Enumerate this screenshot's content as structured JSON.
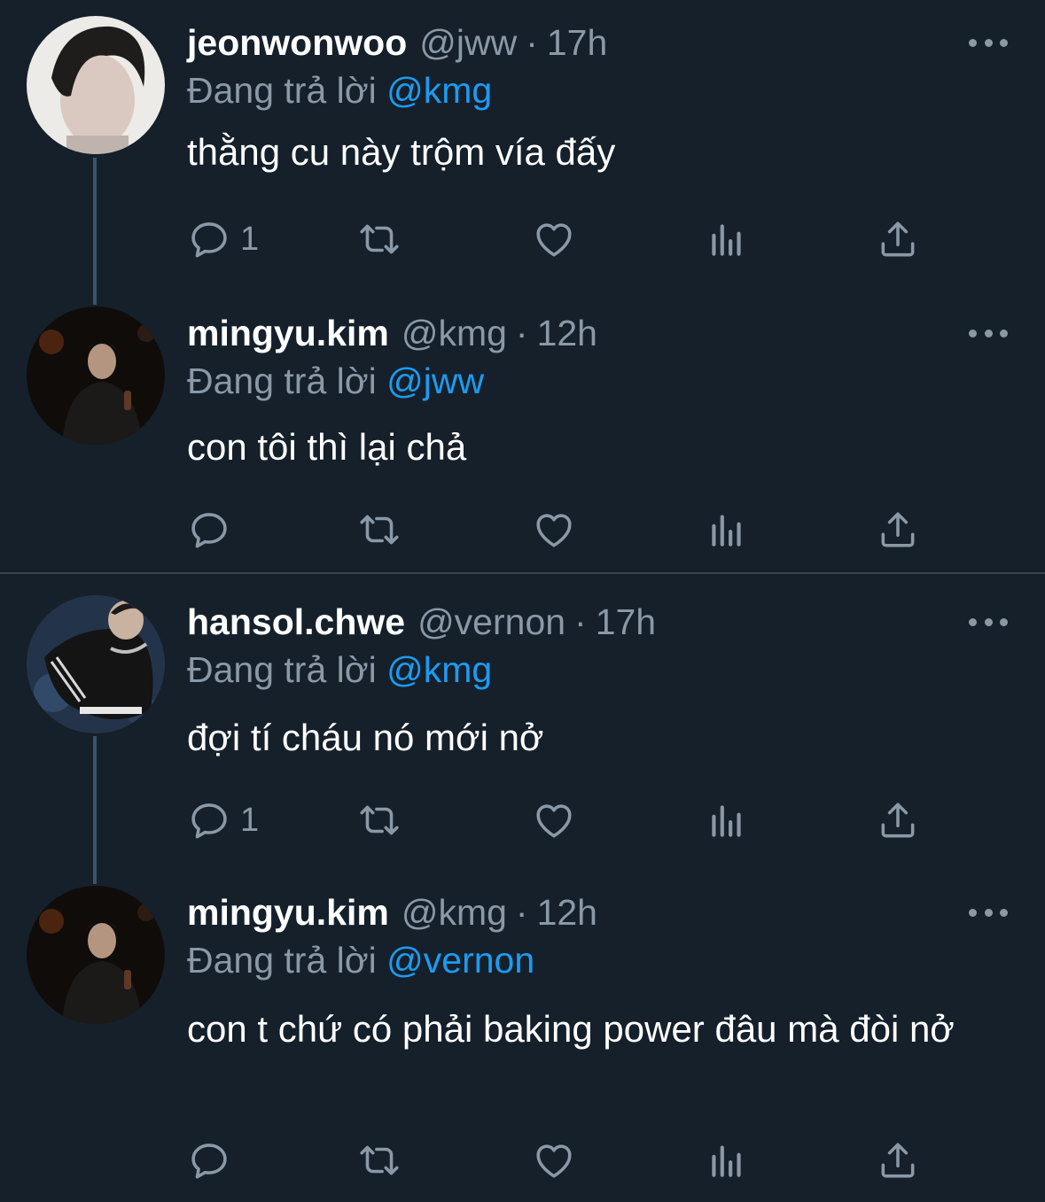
{
  "reply_prefix": "Đang trả lời",
  "tweets": [
    {
      "name": "jeonwonwoo",
      "handle": "@jww",
      "separator": "·",
      "time": "17h",
      "reply_to": "@kmg",
      "text": "thằng cu này trộm vía đấy",
      "reply_count": "1"
    },
    {
      "name": "mingyu.kim",
      "handle": "@kmg",
      "separator": "·",
      "time": "12h",
      "reply_to": "@jww",
      "text": "con tôi thì lại chả",
      "reply_count": ""
    },
    {
      "name": "hansol.chwe",
      "handle": "@vernon",
      "separator": "·",
      "time": "17h",
      "reply_to": "@kmg",
      "text": "đợi tí cháu nó mới nở",
      "reply_count": "1"
    },
    {
      "name": "mingyu.kim",
      "handle": "@kmg",
      "separator": "·",
      "time": "12h",
      "reply_to": "@vernon",
      "text": "con t chứ có phải baking power đâu mà đòi nở",
      "reply_count": ""
    }
  ],
  "icons": {
    "reply": "reply-icon",
    "retweet": "retweet-icon",
    "like": "heart-icon",
    "views": "analytics-icon",
    "share": "share-icon",
    "more": "more-icon"
  },
  "colors": {
    "background": "#15202b",
    "muted": "#8b98a5",
    "accent": "#1d9bf0",
    "thread_line": "#3d5466",
    "divider": "#38444d"
  }
}
